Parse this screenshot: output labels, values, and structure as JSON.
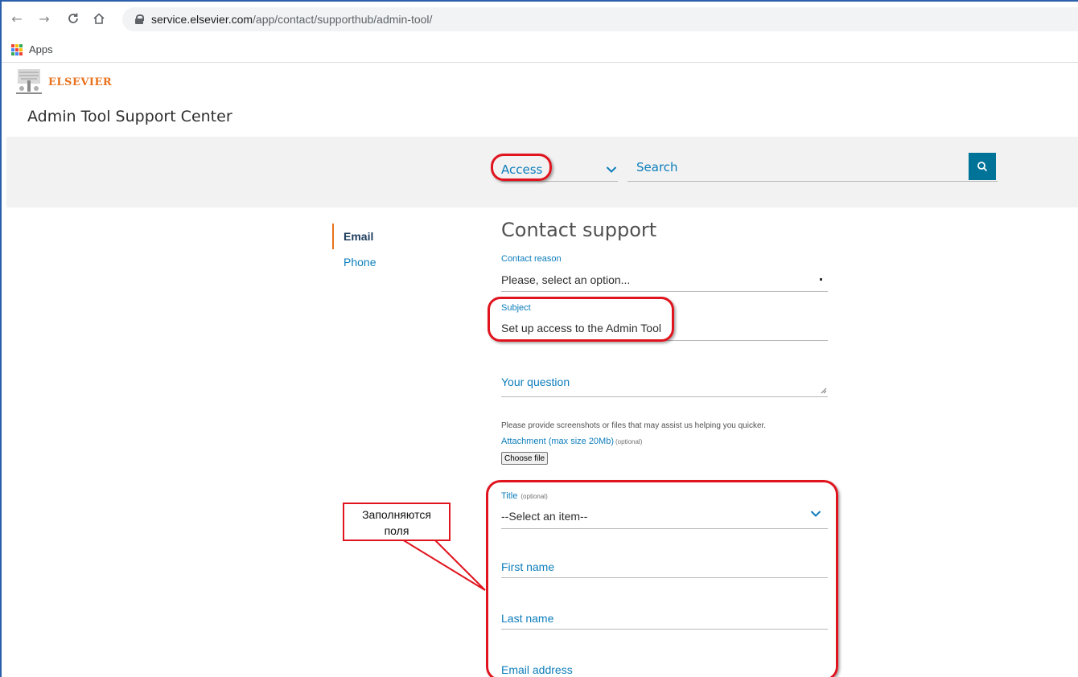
{
  "browser": {
    "url_host": "service.elsevier.com",
    "url_path": "/app/contact/supporthub/admin-tool/",
    "bookmark_apps": "Apps",
    "icons": [
      "back-icon",
      "forward-icon",
      "reload-icon",
      "home-icon",
      "lock-icon",
      "apps-grid-icon"
    ]
  },
  "header": {
    "brand": "ELSEVIER",
    "site_title": "Admin Tool Support Center"
  },
  "search": {
    "category_value": "Access",
    "placeholder": "Search"
  },
  "sidenav": {
    "items": [
      {
        "label": "Email",
        "active": true
      },
      {
        "label": "Phone",
        "active": false
      }
    ]
  },
  "form": {
    "title": "Contact support",
    "contact_reason_label": "Contact reason",
    "contact_reason_value": "Please, select an option...",
    "subject_label": "Subject",
    "subject_value": "Set up access to the Admin Tool",
    "question_placeholder": "Your question",
    "help_text": "Please provide screenshots or files that may assist us helping you quicker.",
    "attachment_label": "Attachment (max size 20Mb)",
    "attachment_optional": "(optional)",
    "choose_file": "Choose file",
    "title_label": "Title",
    "title_optional": "(optional)",
    "title_value": "--Select an item--",
    "first_name_placeholder": "First name",
    "last_name_placeholder": "Last name",
    "email_placeholder": "Email address"
  },
  "annotation": {
    "callout_line1": "Заполняются",
    "callout_line2": "поля"
  },
  "colors": {
    "accent_blue": "#0c7dbb",
    "brand_orange": "#e9711c",
    "annotation_red": "#e0141e",
    "search_button": "#007398"
  }
}
